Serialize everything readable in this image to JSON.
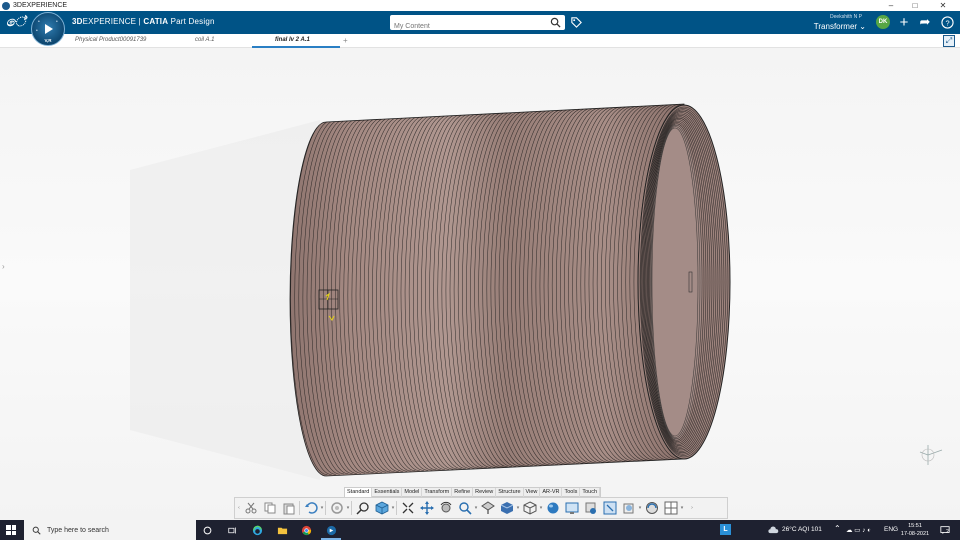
{
  "window": {
    "title": "3DEXPERIENCE",
    "controls": {
      "minimize": "–",
      "maximize": "□",
      "close": "✕"
    }
  },
  "header": {
    "brand_bold": "3D",
    "brand_main": "EXPERIENCE",
    "brand_separator": " | ",
    "brand_app": "CATIA",
    "brand_role": " Part Design",
    "search_placeholder": "My Content",
    "user_name": "Deekshith N P",
    "space": "Transformer ⌄",
    "avatar_initials": "DK",
    "icons": [
      "share-icon",
      "add-icon",
      "help-icon"
    ]
  },
  "compass": {
    "label": "V,R"
  },
  "tabs": [
    {
      "label": "Physical Product00091739",
      "active": false
    },
    {
      "label": "coil A.1",
      "active": false
    },
    {
      "label": "final lv 2 A.1",
      "active": true
    }
  ],
  "tab_add": "+",
  "action_tabs": [
    {
      "label": "Standard",
      "active": true
    },
    {
      "label": "Essentials",
      "active": false
    },
    {
      "label": "Model",
      "active": false
    },
    {
      "label": "Transform",
      "active": false
    },
    {
      "label": "Refine",
      "active": false
    },
    {
      "label": "Review",
      "active": false
    },
    {
      "label": "Structure",
      "active": false
    },
    {
      "label": "View",
      "active": false
    },
    {
      "label": "AR-VR",
      "active": false
    },
    {
      "label": "Tools",
      "active": false
    },
    {
      "label": "Touch",
      "active": false
    }
  ],
  "model": {
    "fill_color": "#a58a83",
    "edge_color": "#1a1a1a"
  },
  "taskbar": {
    "search_text": "Type here to search",
    "weather": "26°C  AQI 101",
    "language": "ENG",
    "time": "15:51",
    "date": "17-08-2021",
    "notification_count": "2"
  }
}
